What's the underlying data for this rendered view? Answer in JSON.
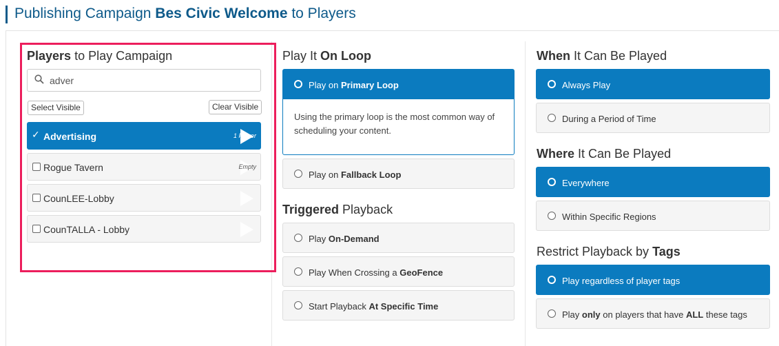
{
  "header": {
    "title_prefix": "Publishing Campaign ",
    "campaign_name": "Bes Civic Welcome",
    "title_suffix": " to Players"
  },
  "players_section": {
    "title_bold": "Players",
    "title_rest": " to Play Campaign",
    "search": {
      "value": "adver",
      "icon": "search-icon"
    },
    "select_visible_label": "Select Visible",
    "clear_visible_label": "Clear Visible",
    "items": [
      {
        "name": "Advertising",
        "meta": "1 Player",
        "checked": true
      },
      {
        "name": "Rogue Tavern",
        "meta": "Empty",
        "checked": false
      },
      {
        "name": "CounLEE-Lobby",
        "meta": "",
        "checked": false
      },
      {
        "name": "CounTALLA - Lobby",
        "meta": "",
        "checked": false
      }
    ]
  },
  "loop_section": {
    "title_pre": "Play It ",
    "title_bold": "On Loop",
    "primary": {
      "pre": "Play on ",
      "bold": "Primary Loop",
      "description": "Using the primary loop is the most common way of scheduling your content."
    },
    "fallback": {
      "pre": "Play on ",
      "bold": "Fallback Loop"
    }
  },
  "triggered_section": {
    "title_bold": "Triggered",
    "title_rest": " Playback",
    "options": [
      {
        "pre": "Play ",
        "bold": "On-Demand"
      },
      {
        "pre": "Play When Crossing a ",
        "bold": "GeoFence"
      },
      {
        "pre": "Start Playback ",
        "bold": "At Specific Time"
      }
    ]
  },
  "when_section": {
    "title_bold": "When",
    "title_rest": " It Can Be Played",
    "always": "Always Play",
    "period": "During a Period of Time"
  },
  "where_section": {
    "title_bold": "Where",
    "title_rest": " It Can Be Played",
    "everywhere": "Everywhere",
    "regions": "Within Specific Regions"
  },
  "tags_section": {
    "title_pre": "Restrict Playback by ",
    "title_bold": "Tags",
    "regardless": "Play regardless of player tags",
    "only_pre": "Play ",
    "only_bold": "only",
    "only_mid": " on players that have ",
    "only_bold2": "ALL",
    "only_post": " these tags"
  },
  "colors": {
    "accent": "#0b7bbf",
    "header_text": "#0e5a8a",
    "highlight_border": "#ec1e5c"
  }
}
